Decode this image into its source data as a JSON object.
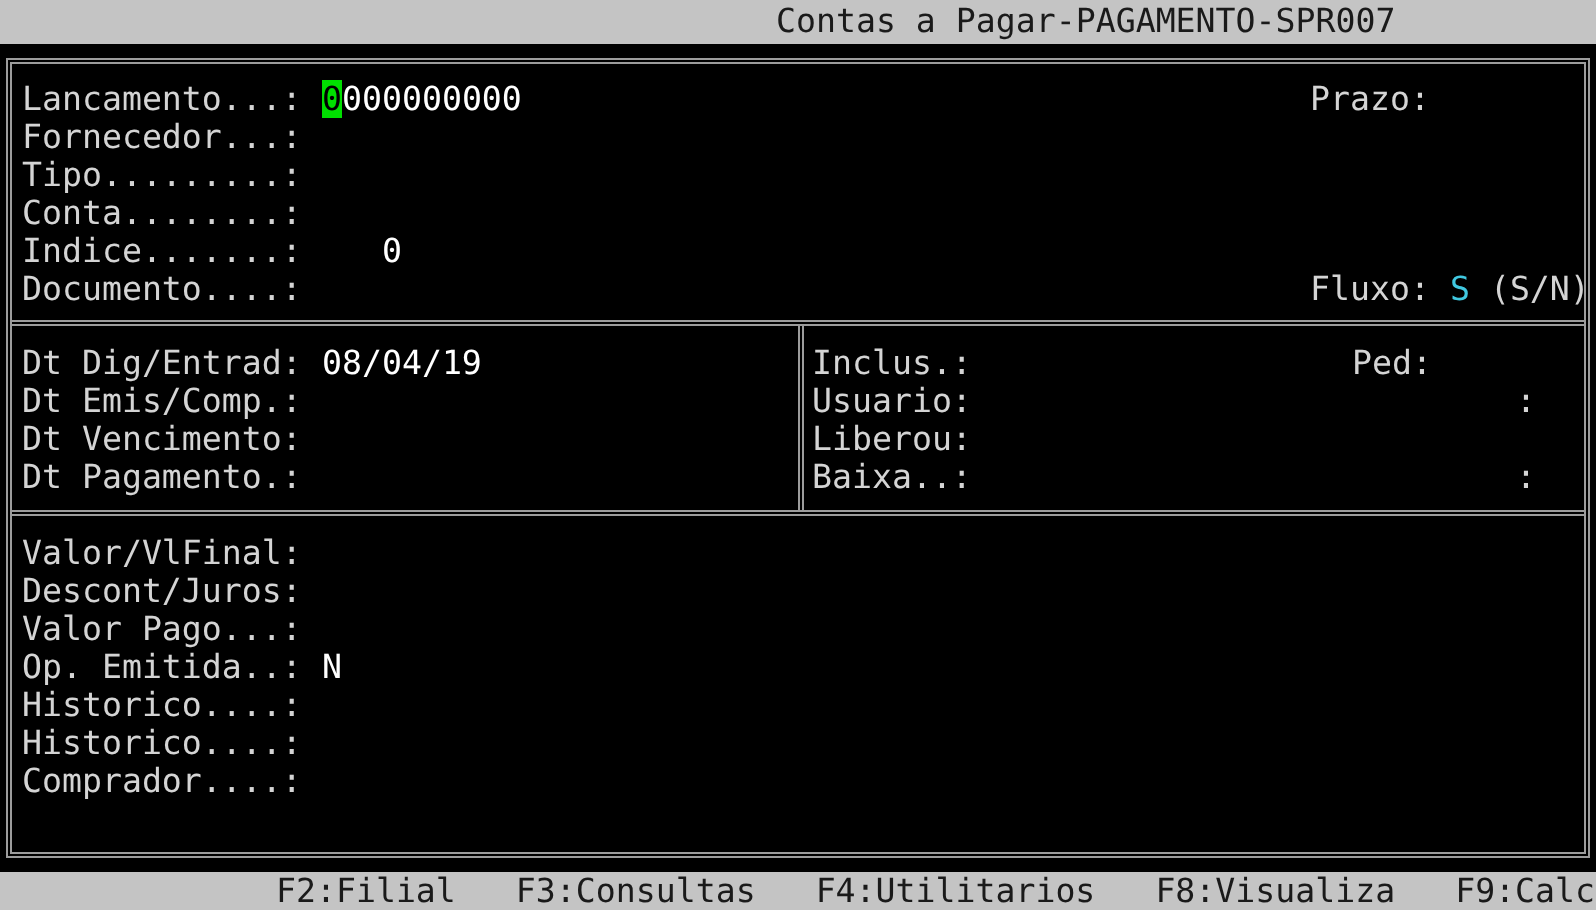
{
  "window": {
    "title": "Contas a Pagar-PAGAMENTO-SPR007"
  },
  "header": {
    "fields": [
      {
        "label": "Lancamento...:",
        "value": "0000000000",
        "kind": "text",
        "cursor": true
      },
      {
        "label": "Fornecedor...:"
      },
      {
        "label": "Tipo.........:"
      },
      {
        "label": "Conta........:"
      },
      {
        "label": "Indice.......:",
        "value": "0",
        "kind": "numeric"
      },
      {
        "label": "Documento....:"
      }
    ],
    "prazo": {
      "label": "Prazo:"
    },
    "fluxo": {
      "label": "Fluxo:",
      "value": "S",
      "hint": "(S/N)"
    }
  },
  "dates": {
    "left": [
      {
        "label": "Dt Dig/Entrad:",
        "value": "08/04/19"
      },
      {
        "label": "Dt Emis/Comp.:"
      },
      {
        "label": "Dt Vencimento:"
      },
      {
        "label": "Dt Pagamento.:"
      }
    ],
    "right": [
      {
        "label": "Inclus.:",
        "column_2": "Ped:"
      },
      {
        "label": "Usuario:",
        "column_3": ":"
      },
      {
        "label": "Liberou:"
      },
      {
        "label": "Baixa..:",
        "column_3": ":"
      }
    ]
  },
  "values": [
    {
      "label": "Valor/VlFinal:"
    },
    {
      "label": "Descont/Juros:"
    },
    {
      "label": "Valor Pago...:"
    },
    {
      "label": "Op. Emitida..:",
      "value": "N"
    },
    {
      "label": "Historico....:"
    },
    {
      "label": "Historico....:"
    },
    {
      "label": "Comprador....:"
    }
  ],
  "function_keys": [
    "F2:Filial",
    "F3:Consultas",
    "F4:Utilitarios",
    "F8:Visualiza",
    "F9:Calc"
  ]
}
